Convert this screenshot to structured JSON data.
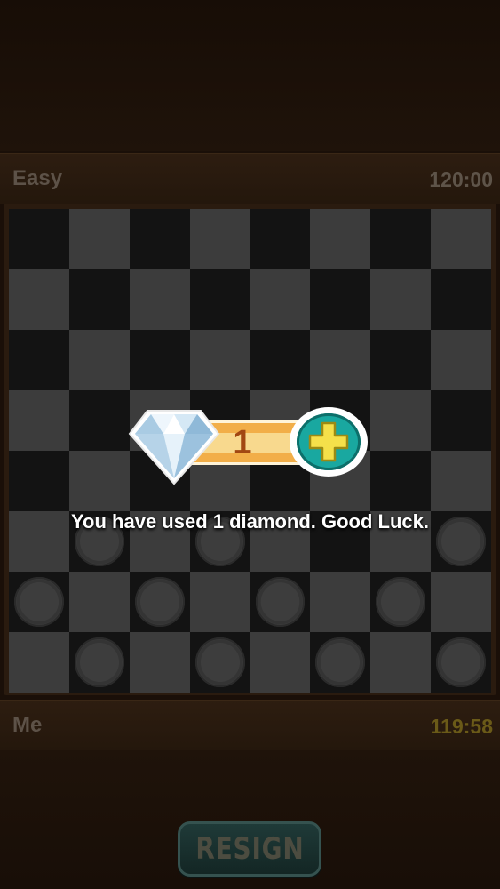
{
  "opponent": {
    "name": "Easy",
    "timer": "120:00"
  },
  "player": {
    "name": "Me",
    "timer": "119:58"
  },
  "board": {
    "rows": [
      [
        "",
        "",
        "",
        "",
        "",
        "",
        "",
        ""
      ],
      [
        "",
        "",
        "",
        "",
        "",
        "",
        "",
        ""
      ],
      [
        "",
        "",
        "",
        "",
        "",
        "",
        "",
        ""
      ],
      [
        "",
        "",
        "",
        "",
        "",
        "",
        "",
        ""
      ],
      [
        "",
        "",
        "",
        "",
        "",
        "",
        "",
        ""
      ],
      [
        "",
        "w",
        "",
        "w",
        "",
        "",
        "",
        "w"
      ],
      [
        "w",
        "",
        "w",
        "",
        "w",
        "",
        "w",
        ""
      ],
      [
        "",
        "w",
        "",
        "w",
        "",
        "w",
        "",
        "w"
      ]
    ]
  },
  "notice": {
    "diamond_count": "1",
    "message": "You have used 1 diamond. Good Luck.",
    "diamond_icon": "diamond-icon",
    "plus_icon": "plus-icon"
  },
  "controls": {
    "resign_label": "RESIGN"
  },
  "colors": {
    "plus_teal": "#19a8a0",
    "plus_yellow": "#f5e04a",
    "pill_orange": "#f2ae48",
    "count_red": "#a24712"
  }
}
